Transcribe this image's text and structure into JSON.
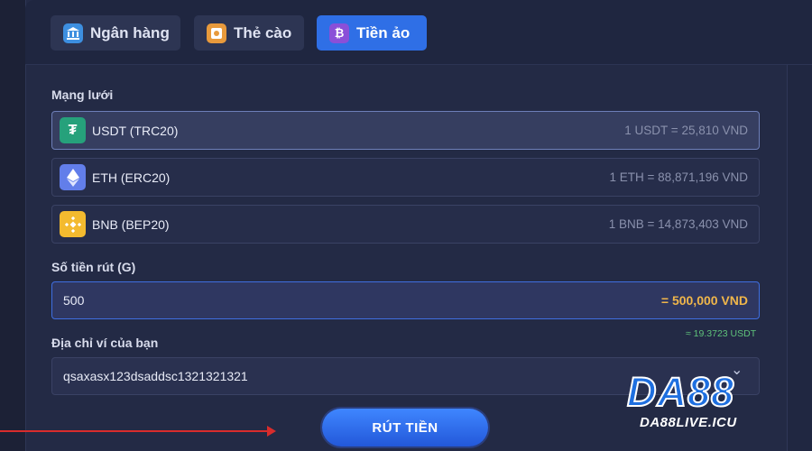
{
  "tabs": [
    {
      "label": "Ngân hàng",
      "icon": "bank-icon",
      "active": false
    },
    {
      "label": "Thẻ cào",
      "icon": "card-icon",
      "active": false
    },
    {
      "label": "Tiền ảo",
      "icon": "bitcoin-icon",
      "active": true
    }
  ],
  "network": {
    "label": "Mạng lưới",
    "items": [
      {
        "name": "USDT (TRC20)",
        "rate": "1 USDT = 25,810 VND",
        "icon": "tether-icon",
        "color": "#26a17b",
        "selected": true
      },
      {
        "name": "ETH (ERC20)",
        "rate": "1 ETH = 88,871,196 VND",
        "icon": "ethereum-icon",
        "color": "#627eea",
        "selected": false
      },
      {
        "name": "BNB (BEP20)",
        "rate": "1 BNB = 14,873,403 VND",
        "icon": "bnb-icon",
        "color": "#f3ba2f",
        "selected": false
      }
    ]
  },
  "amount": {
    "label": "Số tiền rút (G)",
    "value": "500",
    "converted": "= 500,000 VND",
    "usdt_note": "≈ 19.3723 USDT"
  },
  "wallet": {
    "label": "Địa chỉ ví của bạn",
    "value": "qsaxasx123dsaddsc1321321321"
  },
  "submit_label": "RÚT TIỀN",
  "logo": {
    "text": "DA88",
    "sub": "DA88LIVE.ICU"
  }
}
